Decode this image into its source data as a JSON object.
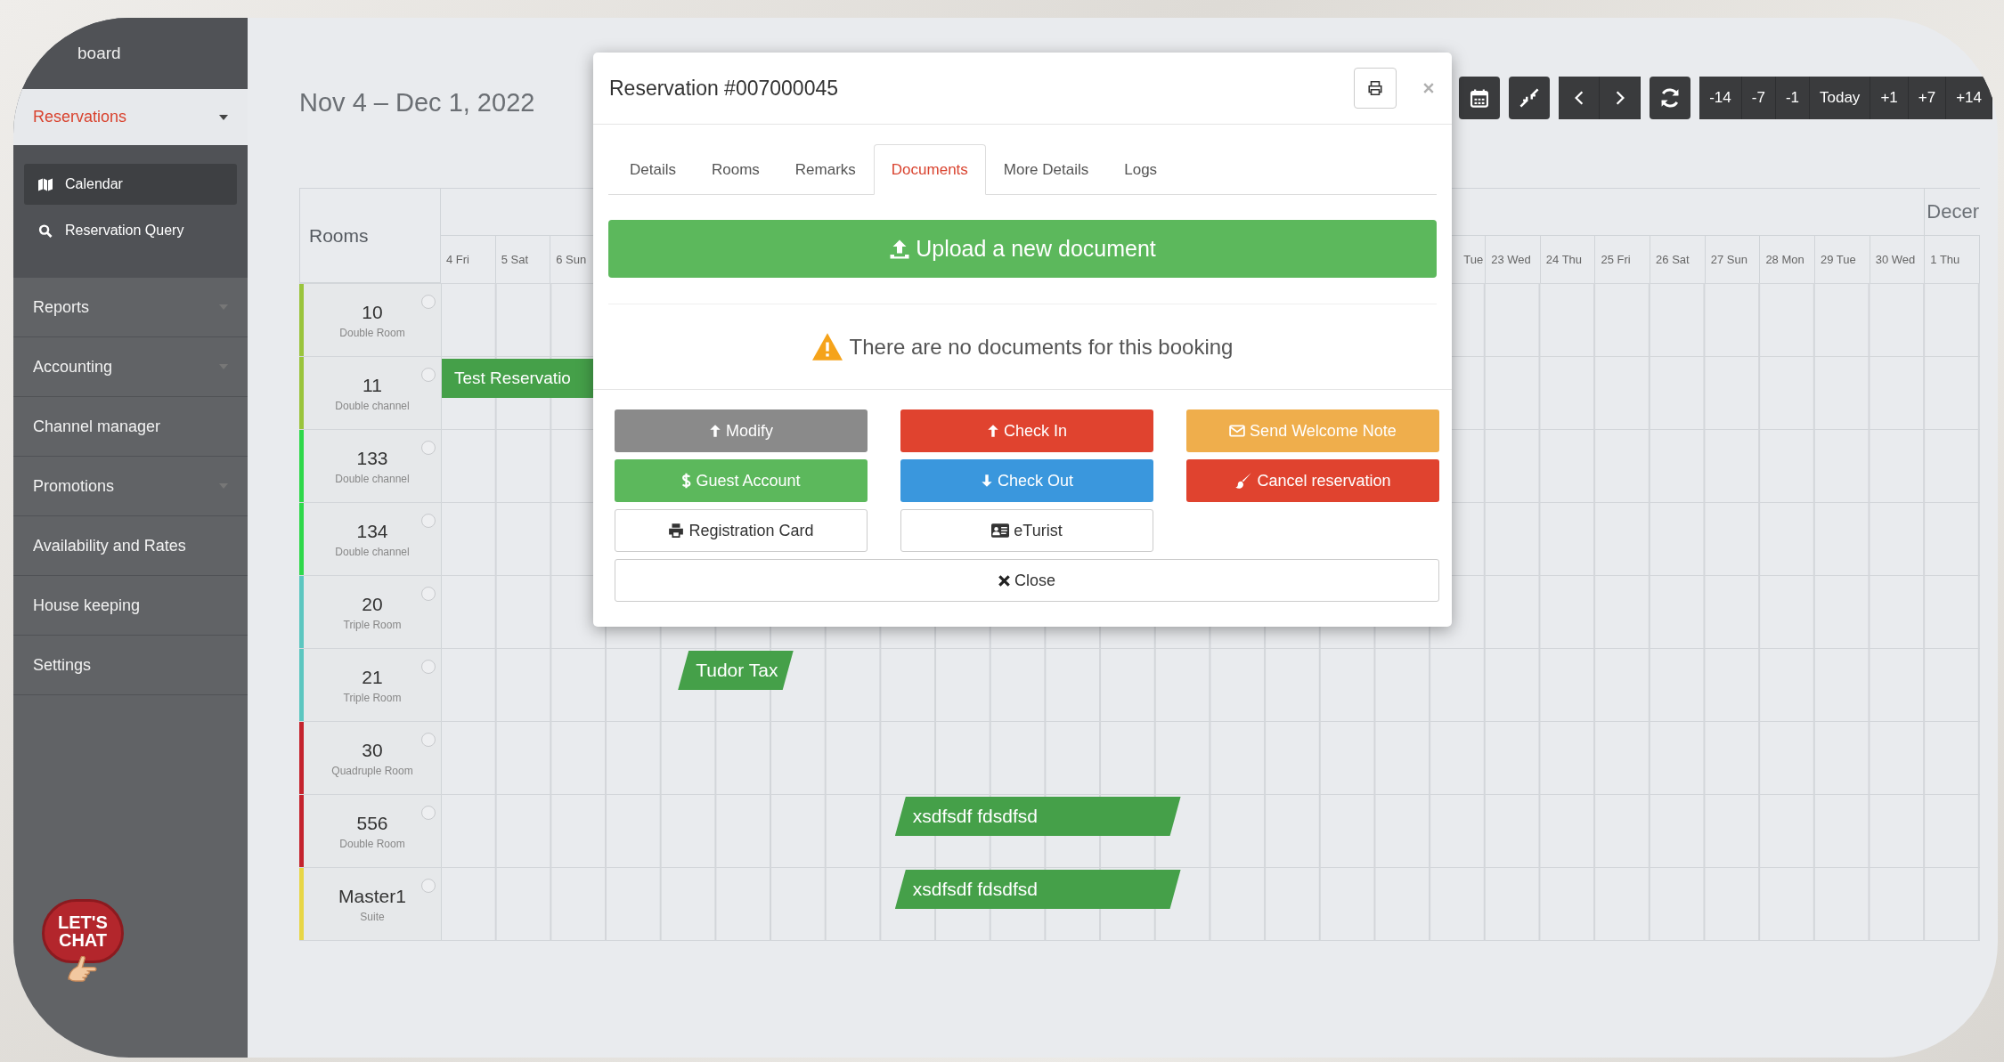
{
  "sidebar": {
    "top_item": "board",
    "items": [
      {
        "label": "Reservations",
        "selected": true,
        "caret": true,
        "children": [
          {
            "label": "Calendar",
            "selected": true
          },
          {
            "label": "Reservation Query",
            "selected": false
          }
        ]
      },
      {
        "label": "Reports",
        "selected": false,
        "caret": true
      },
      {
        "label": "Accounting",
        "selected": false,
        "caret": true
      },
      {
        "label": "Channel manager",
        "selected": false,
        "caret": false
      },
      {
        "label": "Promotions",
        "selected": false,
        "caret": true
      },
      {
        "label": "Availability and Rates",
        "selected": false,
        "caret": false
      },
      {
        "label": "House keeping",
        "selected": false,
        "caret": false
      },
      {
        "label": "Settings",
        "selected": false,
        "caret": false
      }
    ]
  },
  "chat_badge": "LET'S CHAT",
  "header": {
    "date_range": "Nov 4 – Dec 1, 2022",
    "offsets": [
      "-14",
      "-7",
      "-1",
      "Today",
      "+1",
      "+7",
      "+14"
    ]
  },
  "calendar": {
    "rooms_heading": "Rooms",
    "month_label": "Decer",
    "days_start": [
      "4 Fri",
      "5 Sat",
      "6 Sun"
    ],
    "days_end": [
      "Tue",
      "23 Wed",
      "24 Thu",
      "25 Fri",
      "26 Sat",
      "27 Sun",
      "28 Mon",
      "29 Tue",
      "30 Wed",
      "1 Thu"
    ],
    "rooms": [
      {
        "number": "10",
        "type": "Double Room",
        "color": "#9ac43c",
        "selected": false
      },
      {
        "number": "11",
        "type": "Double channel",
        "color": "#9ac43c",
        "selected": false,
        "reservations": [
          "Test Reservatio"
        ]
      },
      {
        "number": "133",
        "type": "Double channel",
        "color": "#2ed84a",
        "selected": false
      },
      {
        "number": "134",
        "type": "Double channel",
        "color": "#2ed84a",
        "selected": false
      },
      {
        "number": "20",
        "type": "Triple Room",
        "color": "#5cc6c0",
        "selected": false
      },
      {
        "number": "21",
        "type": "Triple Room",
        "color": "#5cc6c0",
        "selected": false,
        "reservations": [
          "Tudor Tax"
        ]
      },
      {
        "number": "30",
        "type": "Quadruple Room",
        "color": "#c4232d",
        "selected": false
      },
      {
        "number": "556",
        "type": "Double Room",
        "color": "#c4232d",
        "selected": false,
        "reservations": [
          "xsdfsdf fdsdfsd"
        ]
      },
      {
        "number": "Master1",
        "type": "Suite",
        "color": "#e8d646",
        "selected": false,
        "reservations": [
          "xsdfsdf fdsdfsd"
        ]
      }
    ]
  },
  "modal": {
    "title": "Reservation #007000045",
    "tabs": [
      {
        "label": "Details",
        "selected": false
      },
      {
        "label": "Rooms",
        "selected": false
      },
      {
        "label": "Remarks",
        "selected": false
      },
      {
        "label": "Documents",
        "selected": true
      },
      {
        "label": "More Details",
        "selected": false
      },
      {
        "label": "Logs",
        "selected": false
      }
    ],
    "upload_button": "Upload a new document",
    "notice": "There are no documents for this booking",
    "actions": [
      {
        "label": "Modify",
        "kind": "secondary"
      },
      {
        "label": "Check In",
        "kind": "danger"
      },
      {
        "label": "Send Welcome Note",
        "kind": "warning"
      },
      {
        "label": "Guest Account",
        "kind": "success"
      },
      {
        "label": "Check Out",
        "kind": "info"
      },
      {
        "label": "Cancel reservation",
        "kind": "danger"
      },
      {
        "label": "Registration Card",
        "kind": "outline"
      },
      {
        "label": "eTurist",
        "kind": "outline"
      }
    ],
    "close_button": "Close"
  }
}
